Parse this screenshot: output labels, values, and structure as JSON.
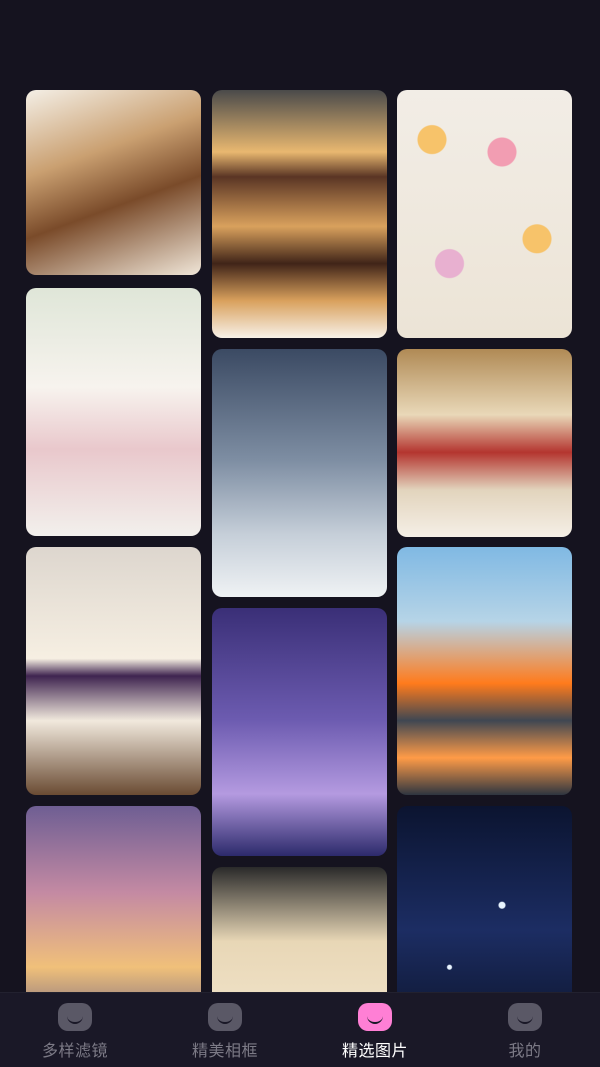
{
  "gallery": {
    "columns": [
      [
        {
          "name": "pastry-shop-photo",
          "class": "pastry"
        },
        {
          "name": "macaron-box-photo",
          "class": "macaron"
        },
        {
          "name": "blueberry-cheesecake-photo",
          "class": "cheesecake"
        },
        {
          "name": "castle-sunset-photo",
          "class": "castle-sunset"
        }
      ],
      [
        {
          "name": "donut-stack-photo",
          "class": "donut"
        },
        {
          "name": "snowy-street-photo",
          "class": "snow"
        },
        {
          "name": "purple-castle-photo",
          "class": "castle-purple"
        },
        {
          "name": "building-facade-photo",
          "class": "facade"
        }
      ],
      [
        {
          "name": "fruit-tarts-photo",
          "class": "tarts"
        },
        {
          "name": "bread-with-jam-photo",
          "class": "bread"
        },
        {
          "name": "orange-bus-photo",
          "class": "bus"
        },
        {
          "name": "fireworks-photo",
          "class": "fireworks"
        }
      ]
    ]
  },
  "tabbar": {
    "items": [
      {
        "label": "多样滤镜",
        "icon": "filter-face-icon",
        "active": false
      },
      {
        "label": "精美相框",
        "icon": "frame-face-icon",
        "active": false
      },
      {
        "label": "精选图片",
        "icon": "gallery-face-icon",
        "active": true
      },
      {
        "label": "我的",
        "icon": "profile-face-icon",
        "active": false
      }
    ],
    "colors": {
      "active": "#ffffff",
      "inactive": "#7c7a86",
      "active_icon": "#ff7fd5",
      "inactive_icon": "#5a5866"
    }
  }
}
